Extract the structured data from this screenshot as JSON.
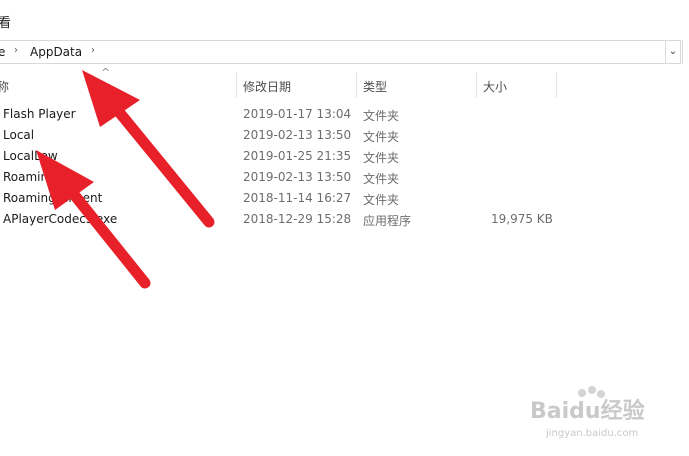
{
  "top": {
    "partial_char": "看"
  },
  "address_bar": {
    "partial_segment": "e",
    "current": "AppData",
    "dropdown_icon": "chevron-down-icon"
  },
  "columns": {
    "name": "称",
    "date": "修改日期",
    "type": "类型",
    "size": "大小"
  },
  "rows": [
    {
      "name": "Flash Player",
      "date": "2019-01-17 13:04",
      "type": "文件夹",
      "size": ""
    },
    {
      "name": "Local",
      "date": "2019-02-13 13:50",
      "type": "文件夹",
      "size": ""
    },
    {
      "name": "LocalLow",
      "date": "2019-01-25 21:35",
      "type": "文件夹",
      "size": ""
    },
    {
      "name": "Roaming",
      "date": "2019-02-13 13:50",
      "type": "文件夹",
      "size": ""
    },
    {
      "name": "RoamingTencent",
      "date": "2018-11-14 16:27",
      "type": "文件夹",
      "size": ""
    },
    {
      "name": "APlayerCodecs.exe",
      "date": "2018-12-29 15:28",
      "type": "应用程序",
      "size": "19,975 KB"
    }
  ],
  "annotation": {
    "arrow_color": "#e8202a"
  },
  "watermark": {
    "text": "Baidu经验",
    "sub": "jingyan.baidu.com"
  }
}
